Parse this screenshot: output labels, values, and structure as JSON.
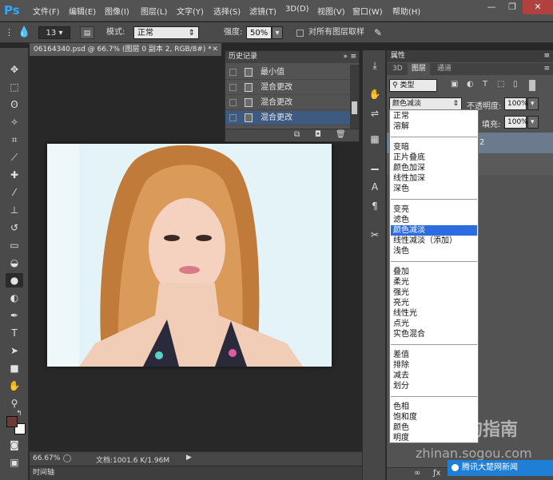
{
  "app": {
    "logo": "Ps"
  },
  "menu": [
    "文件(F)",
    "编辑(E)",
    "图像(I)",
    "图层(L)",
    "文字(Y)",
    "选择(S)",
    "滤镜(T)",
    "3D(D)",
    "视图(V)",
    "窗口(W)",
    "帮助(H)"
  ],
  "window_controls": {
    "minimize": "—",
    "restore": "❐",
    "close": "✕"
  },
  "options": {
    "brush_size": "13",
    "mode_label": "模式:",
    "mode_value": "正常",
    "strength_label": "强度:",
    "strength_value": "50%",
    "sample_all_label": "对所有图层取样"
  },
  "document": {
    "tab_title": "06164340.psd @ 66.7% (图层 0 副本 2, RGB/8#) *",
    "zoom": "66.67%",
    "doc_size": "文档:1001.6 K/1.96M",
    "timeline_label": "时间轴"
  },
  "history": {
    "title": "历史记录",
    "items": [
      {
        "label": "最小值"
      },
      {
        "label": "混合更改"
      },
      {
        "label": "混合更改"
      },
      {
        "label": "混合更改"
      }
    ]
  },
  "panels": {
    "properties_title": "属性",
    "tabs": [
      "3D",
      "图层",
      "通道"
    ],
    "filter_kind": "类型",
    "blend_mode": "颜色减淡",
    "opacity_label": "不透明度:",
    "opacity_value": "100%",
    "fill_label": "填充:",
    "fill_value": "100%",
    "layer_suffix": "2"
  },
  "blend_modes": {
    "groups": [
      [
        "正常",
        "溶解"
      ],
      [
        "变暗",
        "正片叠底",
        "颜色加深",
        "线性加深",
        "深色"
      ],
      [
        "变亮",
        "滤色",
        "颜色减淡",
        "线性减淡（添加）",
        "浅色"
      ],
      [
        "叠加",
        "柔光",
        "强光",
        "亮光",
        "线性光",
        "点光",
        "实色混合"
      ],
      [
        "差值",
        "排除",
        "减去",
        "划分"
      ],
      [
        "色相",
        "饱和度",
        "颜色",
        "明度"
      ]
    ],
    "selected": "颜色减淡"
  },
  "watermark": {
    "brand": "搜狗指南",
    "url": "zhinan.sogou.com",
    "badge": "腾讯大楚网新闻"
  },
  "colors": {
    "foreground": "#6b3a36",
    "background": "#ffffff",
    "selection": "#2d6be0"
  }
}
